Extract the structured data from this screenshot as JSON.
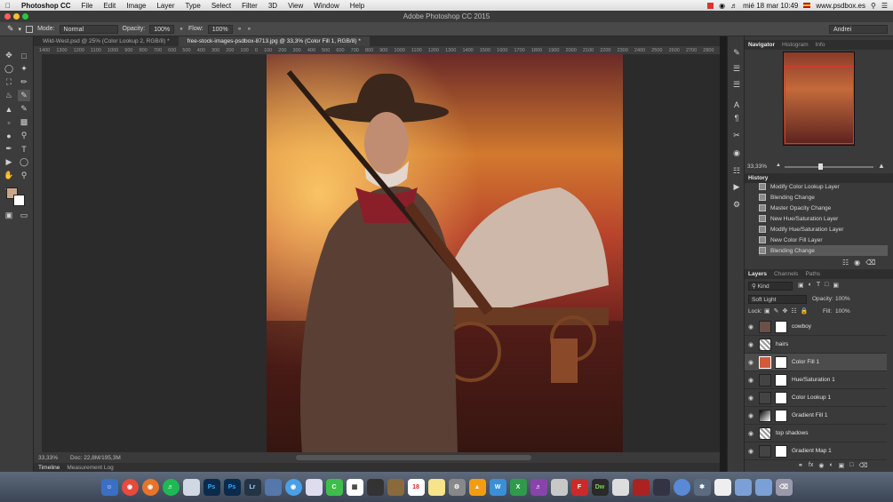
{
  "menubar": {
    "app": "Photoshop CC",
    "items": [
      "File",
      "Edit",
      "Image",
      "Layer",
      "Type",
      "Select",
      "Filter",
      "3D",
      "View",
      "Window",
      "Help"
    ],
    "clock": "mié 18 mar 10:49",
    "site": "www.psdbox.es"
  },
  "window": {
    "title": "Adobe Photoshop CC 2015",
    "user": "Andrei"
  },
  "options": {
    "mode_label": "Mode:",
    "mode_value": "Normal",
    "opacity_label": "Opacity:",
    "opacity_value": "100%",
    "flow_label": "Flow:",
    "flow_value": "100%"
  },
  "tabs": [
    {
      "label": "Wild-West.psd @ 25% (Color Lookup 2, RGB/8) *"
    },
    {
      "label": "free-stock-images-psdbox-8713.jpg @ 33,3% (Color Fill 1, RGB/8) *"
    }
  ],
  "ruler": [
    "1400",
    "1300",
    "1200",
    "1100",
    "1000",
    "900",
    "800",
    "700",
    "600",
    "500",
    "400",
    "300",
    "200",
    "100",
    "0",
    "100",
    "200",
    "300",
    "400",
    "500",
    "600",
    "700",
    "800",
    "900",
    "1000",
    "1100",
    "1200",
    "1300",
    "1400",
    "1500",
    "1600",
    "1700",
    "1800",
    "1900",
    "2000",
    "2100",
    "2200",
    "2300",
    "2400",
    "2500",
    "2600",
    "2700",
    "2800"
  ],
  "status": {
    "zoom": "33,33%",
    "doc": "Doc: 22,8M/195,3M"
  },
  "bottom_tabs": [
    "Timeline",
    "Measurement Log"
  ],
  "navigator": {
    "tabs": [
      "Navigator",
      "Histogram",
      "Info"
    ],
    "zoom": "33,33%"
  },
  "history": {
    "title": "History",
    "items": [
      "Modify Color Lookup Layer",
      "Blending Change",
      "Master Opacity Change",
      "New Hue/Saturation Layer",
      "Modify Hue/Saturation Layer",
      "New Color Fill Layer",
      "Blending Change"
    ]
  },
  "layers": {
    "tabs": [
      "Layers",
      "Channels",
      "Paths"
    ],
    "kind": "Kind",
    "blend": "Soft Light",
    "opacity_label": "Opacity:",
    "opacity": "100%",
    "lock_label": "Lock:",
    "fill_label": "Fill:",
    "fill": "100%",
    "items": [
      "cowboy",
      "hairs",
      "Color Fill 1",
      "Hue/Saturation 1",
      "Color Lookup 1",
      "Gradient Fill 1",
      "top shadows",
      "Gradient Map 1"
    ]
  },
  "dock": {
    "apps": [
      "Ps",
      "Ps",
      "Lr",
      "Dw"
    ]
  },
  "colors": {
    "fill_swatch": "#d45a3a",
    "accent": "#e0352b"
  }
}
